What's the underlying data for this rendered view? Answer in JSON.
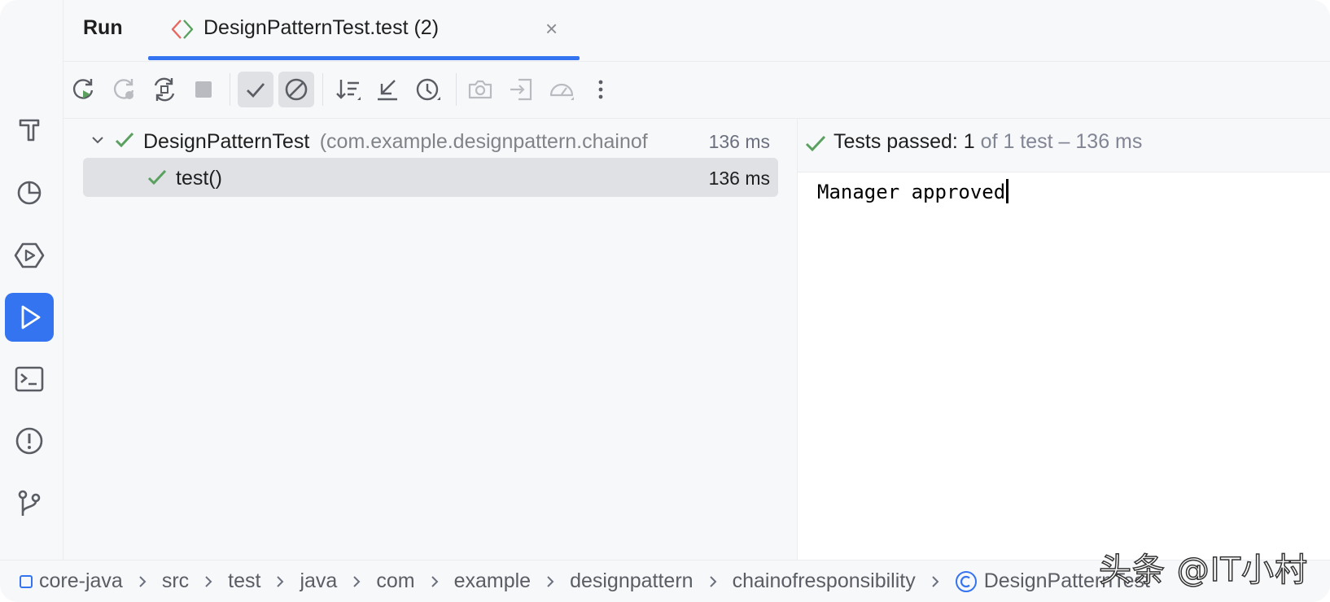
{
  "header": {
    "run_label": "Run",
    "tab_title": "DesignPatternTest.test (2)",
    "tab_close": "×"
  },
  "toolbar": {
    "buttons": [
      "rerun-icon",
      "rerun-failed-icon",
      "toggle-auto-test-icon",
      "stop-icon",
      "show-passed-icon",
      "show-ignored-icon",
      "sort-icon",
      "collapse-icon",
      "history-icon",
      "export-icon",
      "import-icon",
      "coverage-icon",
      "more-icon"
    ]
  },
  "tree": {
    "root": {
      "name": "DesignPatternTest",
      "package": "(com.example.designpattern.chainof",
      "time": "136 ms"
    },
    "child": {
      "name": "test()",
      "time": "136 ms"
    }
  },
  "console": {
    "status_main": "Tests passed: 1",
    "status_dim": " of 1 test – 136 ms",
    "output": "Manager approved"
  },
  "breadcrumb": {
    "items": [
      "core-java",
      "src",
      "test",
      "java",
      "com",
      "example",
      "designpattern",
      "chainofresponsibility",
      "DesignPatternTest"
    ]
  },
  "watermark": "头条 @IT小村",
  "colors": {
    "accent": "#3574f0",
    "pass_green": "#5aa05e",
    "panel_bg": "#f7f8fa"
  }
}
